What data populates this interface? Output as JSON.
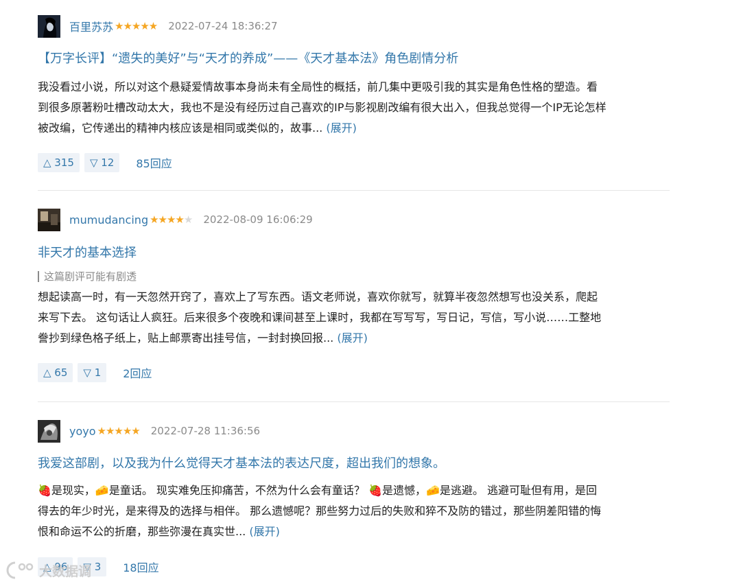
{
  "reviews": [
    {
      "author": "百里苏苏",
      "rating": 5,
      "stars": "★★★★★",
      "time": "2022-07-24 18:36:27",
      "title": "【万字长评】“遗失的美好”与“天才的养成”——《天才基本法》角色剧情分析",
      "spoiler": "",
      "body_lines": [
        "我没看过小说，所以对这个悬疑爱情故事本身尚未有全局性的概括，前几集中更吸引我的其实是角色性格的塑造。看",
        "到很多原著粉吐槽改动太大，我也不是没有经历过自己喜欢的IP与影视剧改编有很大出入，但我总觉得一个IP无论怎样",
        "被改编，它传递出的精神内核应该是相同或类似的，故事..."
      ],
      "expand": "(展开)",
      "up": "△ 315",
      "down": "▽ 12",
      "replies": "85回应"
    },
    {
      "author": "mumudancing",
      "rating": 4,
      "stars_on": "★★★★",
      "stars_off": "★",
      "time": "2022-08-09 16:06:29",
      "title": "非天才的基本选择",
      "spoiler": "这篇剧评可能有剧透",
      "body_lines": [
        "想起读高一时，有一天忽然开窍了，喜欢上了写东西。语文老师说，喜欢你就写，就算半夜忽然想写也没关系，爬起",
        "来写下去。 这句话让人疯狂。后来很多个夜晚和课间甚至上课时，我都在写写写，写日记，写信，写小说……工整地",
        "誊抄到绿色格子纸上，贴上邮票寄出挂号信，一封封换回报..."
      ],
      "expand": "(展开)",
      "up": "△ 65",
      "down": "▽ 1",
      "replies": "2回应"
    },
    {
      "author": "yoyo",
      "rating": 5,
      "stars": "★★★★★",
      "time": "2022-07-28 11:36:56",
      "title": "我爱这部剧，以及我为什么觉得天才基本法的表达尺度，超出我们的想象。",
      "spoiler": "",
      "body_lines": [
        "🍓是现实，🧀是童话。 现实难免压抑痛苦，不然为什么会有童话？ 🍓是遗憾，🧀是逃避。 逃避可耻但有用，是回",
        "得去的年少时光，是来得及的选择与相伴。 那么遗憾呢？那些努力过后的失败和猝不及防的错过，那些阴差阳错的悔",
        "恨和命运不公的折磨，那些弥漫在真实世..."
      ],
      "expand": "(展开)",
      "up": "△ 96",
      "down": "▽ 3",
      "replies": "18回应"
    }
  ],
  "watermark": "大数据调",
  "colors": {
    "link": "#3377aa",
    "star": "#f5a623",
    "muted": "#8a8a8a",
    "vote_bg": "#eef2f7"
  }
}
